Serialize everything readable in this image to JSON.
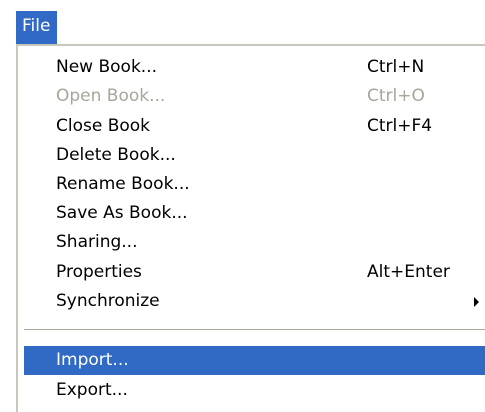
{
  "menubar": {
    "title": "File"
  },
  "menu": {
    "items": [
      {
        "label": "New Book...",
        "shortcut": "Ctrl+N"
      },
      {
        "label": "Open Book...",
        "shortcut": "Ctrl+O",
        "disabled": true
      },
      {
        "label": "Close Book",
        "shortcut": "Ctrl+F4"
      },
      {
        "label": "Delete Book..."
      },
      {
        "label": "Rename Book..."
      },
      {
        "label": "Save As Book..."
      },
      {
        "label": "Sharing..."
      },
      {
        "label": "Properties",
        "shortcut": "Alt+Enter"
      },
      {
        "label": "Synchronize",
        "submenu": true
      }
    ],
    "items_after_separator": [
      {
        "label": "Import...",
        "highlighted": true
      },
      {
        "label": "Export..."
      }
    ]
  },
  "colors": {
    "highlight": "#316ac5",
    "disabled_text": "#a8a699"
  },
  "icons": {
    "submenu": "chevron-right-icon"
  }
}
